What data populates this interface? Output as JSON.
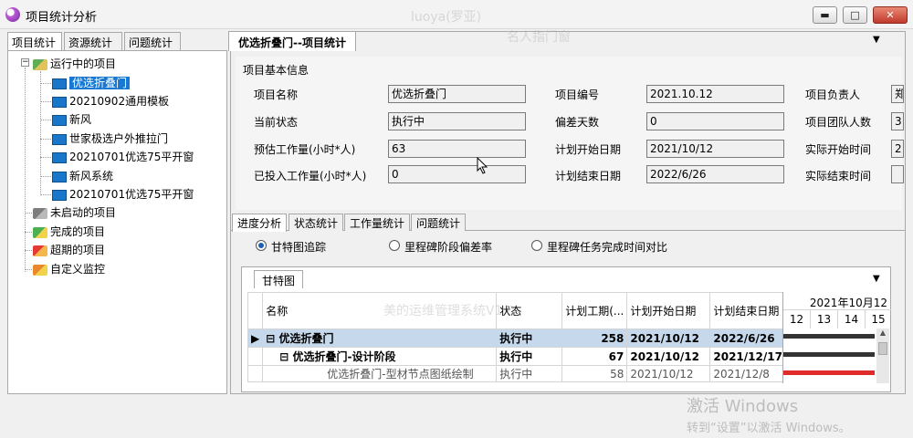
{
  "window": {
    "title": "项目统计分析",
    "minimize": "▬",
    "maximize": "□",
    "close": "✕"
  },
  "left_tabs": [
    "项目统计",
    "资源统计",
    "问题统计"
  ],
  "tree": {
    "running": "运行中的项目",
    "running_children": [
      "优选折叠门",
      "20210902通用模板",
      "新风",
      "世家极选户外推拉门",
      "20210701优选75平开窗",
      "新风系统",
      "20210701优选75平开窗"
    ],
    "not_started": "未启动的项目",
    "completed": "完成的项目",
    "overdue": "超期的项目",
    "custom": "自定义监控"
  },
  "doc_tab": "优选折叠门--项目统计",
  "dropdown_arrow": "▼",
  "info": {
    "section_title": "项目基本信息",
    "name_label": "项目名称",
    "name_value": "优选折叠门",
    "state_label": "当前状态",
    "state_value": "执行中",
    "est_label": "预估工作量(小时*人)",
    "est_value": "63",
    "spent_label": "已投入工作量(小时*人)",
    "spent_value": "0",
    "code_label": "项目编号",
    "code_value": "2021.10.12",
    "dev_label": "偏差天数",
    "dev_value": "0",
    "pstart_label": "计划开始日期",
    "pstart_value": "2021/10/12",
    "pend_label": "计划结束日期",
    "pend_value": "2022/6/26",
    "owner_label": "项目负责人",
    "owner_value": "郑",
    "team_label": "项目团队人数",
    "team_value": "3",
    "astart_label": "实际开始时间",
    "astart_value": "2",
    "aend_label": "实际结束时间",
    "aend_value": ""
  },
  "sub_tabs": [
    "进度分析",
    "状态统计",
    "工作量统计",
    "问题统计"
  ],
  "radios": [
    "甘特图追踪",
    "里程碑阶段偏差率",
    "里程碑任务完成时间对比"
  ],
  "gantt_tab": "甘特图",
  "grid": {
    "headers": [
      "名称",
      "状态",
      "计划工期(...",
      "计划开始日期",
      "计划结束日期"
    ],
    "rows": [
      {
        "marker": "▶",
        "expander": "⊟",
        "name": "优选折叠门",
        "status": "执行中",
        "days": "258",
        "start": "2021/10/12",
        "end": "2022/6/26"
      },
      {
        "marker": "",
        "expander": "⊟",
        "name": "优选折叠门-设计阶段",
        "status": "执行中",
        "days": "67",
        "start": "2021/10/12",
        "end": "2021/12/17"
      },
      {
        "marker": "",
        "expander": "",
        "name": "优选折叠门-型材节点图纸绘制",
        "status": "执行中",
        "days": "58",
        "start": "2021/10/12",
        "end": "2021/12/8"
      }
    ]
  },
  "gantt_header": {
    "month": "2021年10月12",
    "days": [
      "12",
      "13",
      "14",
      "15"
    ]
  },
  "watermarks": [
    "luoya(罗亚)",
    "名人指门窗",
    "美的运维管理系统V1.0"
  ],
  "activate": {
    "line1": "激活 Windows",
    "line2": "转到“设置”以激活 Windows。"
  }
}
